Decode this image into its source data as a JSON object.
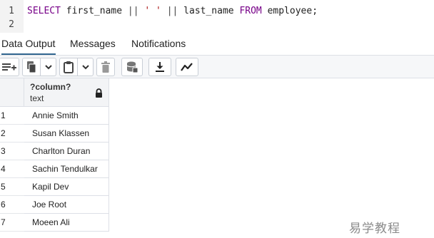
{
  "editor": {
    "lines": [
      {
        "number": "1"
      },
      {
        "number": "2"
      }
    ],
    "sql": {
      "kw_select": "SELECT",
      "col1": " first_name ",
      "op1": "||",
      "space_str": " ' ' ",
      "op2": "||",
      "col2": " last_name ",
      "kw_from": "FROM",
      "table": " employee;"
    }
  },
  "tabs": [
    {
      "label": "Data Output",
      "active": true
    },
    {
      "label": "Messages",
      "active": false
    },
    {
      "label": "Notifications",
      "active": false
    }
  ],
  "toolbar": {
    "icons": [
      "add-row-icon",
      "copy-icon",
      "copy-dropdown-icon",
      "paste-icon",
      "paste-dropdown-icon",
      "delete-icon",
      "save-data-icon",
      "download-icon",
      "graph-icon"
    ]
  },
  "grid": {
    "column": {
      "name": "?column?",
      "type": "text",
      "locked": true
    },
    "rows": [
      {
        "num": "1",
        "value": "Annie Smith"
      },
      {
        "num": "2",
        "value": "Susan Klassen"
      },
      {
        "num": "3",
        "value": "Charlton Duran"
      },
      {
        "num": "4",
        "value": "Sachin Tendulkar"
      },
      {
        "num": "5",
        "value": "Kapil Dev"
      },
      {
        "num": "6",
        "value": "Joe Root"
      },
      {
        "num": "7",
        "value": "Moeen Ali"
      }
    ]
  },
  "watermark": "易学教程",
  "colors": {
    "keyword": "#770088",
    "string": "#aa1111",
    "active_tab": "#326690"
  }
}
